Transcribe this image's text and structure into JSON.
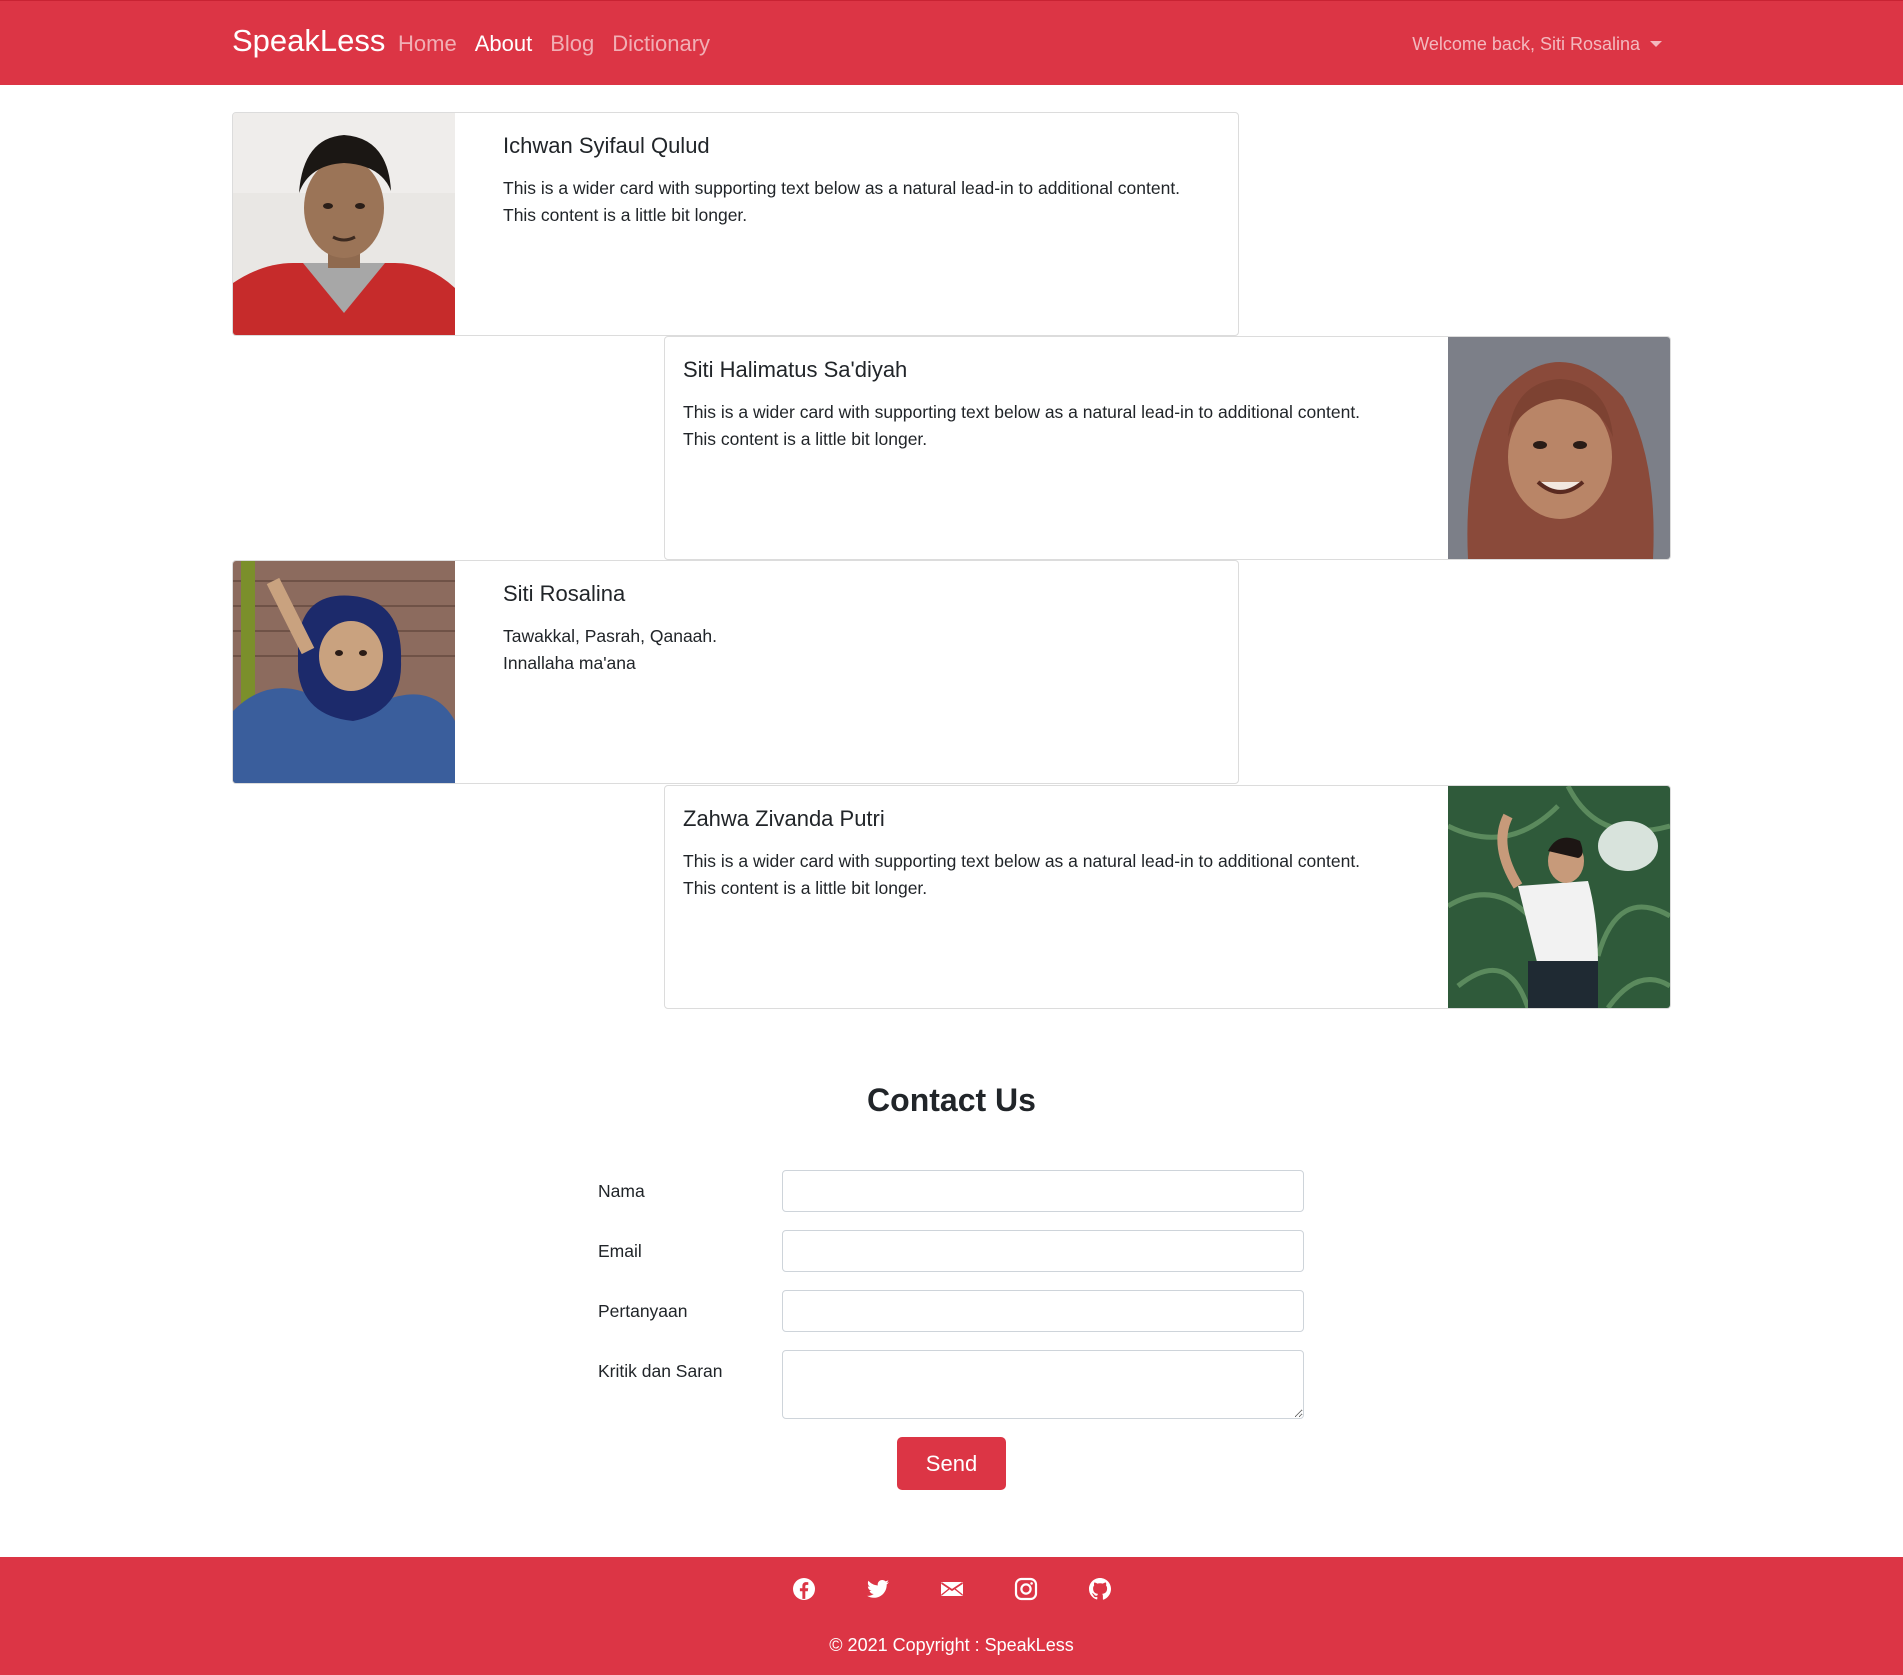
{
  "navbar": {
    "brand": "SpeakLess",
    "links": [
      {
        "label": "Home",
        "active": false
      },
      {
        "label": "About",
        "active": true
      },
      {
        "label": "Blog",
        "active": false
      },
      {
        "label": "Dictionary",
        "active": false
      }
    ],
    "user_greeting": "Welcome back, Siti Rosalina"
  },
  "team": [
    {
      "name": "Ichwan Syifaul Qulud",
      "bio": "This is a wider card with supporting text below as a natural lead-in to additional content.\nThis content is a little bit longer."
    },
    {
      "name": "Siti Halimatus Sa'diyah",
      "bio": "This is a wider card with supporting text below as a natural lead-in to additional content.\nThis content is a little bit longer."
    },
    {
      "name": "Siti Rosalina",
      "bio": "Tawakkal, Pasrah, Qanaah.\nInnallaha ma'ana"
    },
    {
      "name": "Zahwa Zivanda Putri",
      "bio": "This is a wider card with supporting text below as a natural lead-in to additional content.\nThis content is a little bit longer."
    }
  ],
  "contact": {
    "title": "Contact Us",
    "fields": [
      {
        "label": "Nama",
        "value": ""
      },
      {
        "label": "Email",
        "value": ""
      },
      {
        "label": "Pertanyaan",
        "value": ""
      },
      {
        "label": "Kritik dan Saran",
        "value": ""
      }
    ],
    "send_label": "Send"
  },
  "footer": {
    "social_icons": [
      "facebook-icon",
      "twitter-icon",
      "mail-icon",
      "instagram-icon",
      "github-icon"
    ],
    "copyright": "© 2021 Copyright : SpeakLess"
  },
  "colors": {
    "brand": "#dc3545",
    "text": "#212529"
  }
}
